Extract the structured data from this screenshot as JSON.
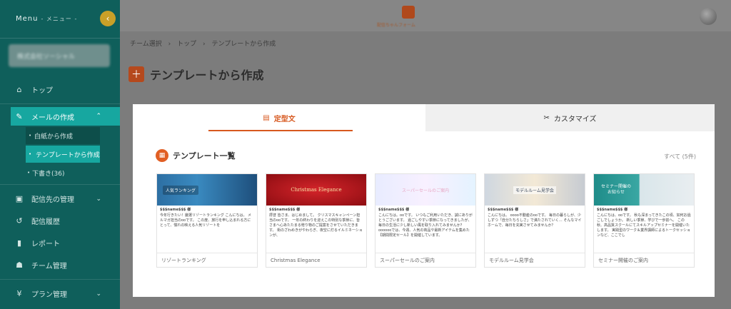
{
  "sidebar": {
    "menu_label": "Menu",
    "menu_sub": "- メニュー -",
    "collapse_glyph": "‹",
    "team_name": "株式会社ソーシャル",
    "items": [
      {
        "label": "トップ",
        "icon": "home-icon"
      },
      {
        "label": "メールの作成",
        "icon": "pencil-icon"
      },
      {
        "label": "配信先の管理",
        "icon": "contact-icon"
      },
      {
        "label": "配信履歴",
        "icon": "history-icon"
      },
      {
        "label": "レポート",
        "icon": "chart-icon"
      },
      {
        "label": "チーム管理",
        "icon": "team-icon"
      },
      {
        "label": "プラン管理",
        "icon": "yen-icon"
      }
    ],
    "subitems": [
      {
        "label": "白紙から作成"
      },
      {
        "label": "テンプレートから作成"
      },
      {
        "label": "下書き(36)"
      }
    ]
  },
  "header": {
    "brand_text": "配信ちゃんフォーム"
  },
  "breadcrumb": [
    "チーム選択",
    "トップ",
    "テンプレートから作成"
  ],
  "breadcrumb_sep": "›",
  "page_title": "テンプレートから作成",
  "tabs": [
    {
      "label": "定型文",
      "icon": "document-icon",
      "active": true
    },
    {
      "label": "カスタマイズ",
      "icon": "tools-icon",
      "active": false
    }
  ],
  "section": {
    "title": "テンプレート一覧",
    "all_link": "すべて (5件)"
  },
  "cards": [
    {
      "name": "リゾートランキング",
      "thumb_text": "人気ランキング",
      "recipient": "$$$name$$$ 様",
      "preview": "今年行きたい！厳選リゾートランキング こんにちは。 メルマガ担当のooです。 この度、旅行を申し込まれる方にとって、憧れの映える人気リゾートを"
    },
    {
      "name": "Christmas Elegance",
      "thumb_text": "Christmas Elegance",
      "recipient": "$$$name$$$ 様",
      "preview": "拝啓 皆さま、はじめまして。 クリスマスキャンペーン担当のooです。 一年の終わりを迎えこの特別な季節に、皆さまへ心あたたまる贈り物のご提案をさせていただきます。 街のざわめきがやわらぎ、夜空に灯るイルミネーションが、"
    },
    {
      "name": "スーパーセールのご案内",
      "thumb_text": "スーパーセールのご案内",
      "recipient": "$$$name$$$ 様",
      "preview": "こんにちは。ooです。 いつもご利用いただき、誠にありがとうございます。 過ごしやすい季節になってきましたが、毎日の生活に少し新しい風を取り入れてみませんか？ ooooooでは、今週、人気の商品や最新アイテムを集めた【期間限定セール】を開催しています。"
    },
    {
      "name": "モデルルーム見学会",
      "thumb_text": "モデルルーム見学会",
      "recipient": "$$$name$$$ 様",
      "preview": "こんにちは。 oooo不動産のooです。 毎日の暮らしが、少しずつ「自分たちらしさ」で満たされていく… そんなマイホームで、毎日を充実させてみませんか？"
    },
    {
      "name": "セミナー開催のご案内",
      "thumb_text": "セミナー開催のお知らせ",
      "recipient": "$$$name$$$ 様",
      "preview": "こんにちは、ooです。 秋も深まってきたこの頃、如何お過ごしでしょうか。 新しい季節、学びで一歩前へ。 この秋、高品質スクールにてスキルアップセミナーを開催いたします。 実践型のワーク＆業界講師によるトークセッションなど、ここでし"
    }
  ]
}
